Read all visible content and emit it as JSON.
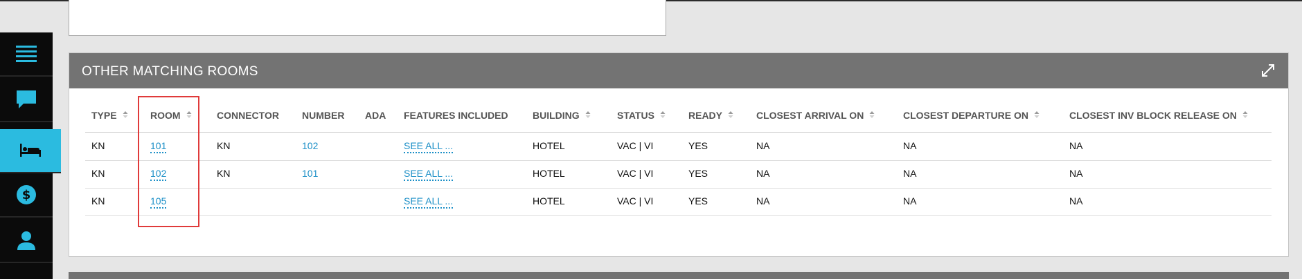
{
  "sidebar": {
    "items": [
      {
        "icon": "menu-icon",
        "active": false
      },
      {
        "icon": "chat-icon",
        "active": false
      },
      {
        "icon": "bed-icon",
        "active": true
      },
      {
        "icon": "dollar-icon",
        "active": false
      },
      {
        "icon": "user-icon",
        "active": false
      }
    ]
  },
  "card": {
    "title": "OTHER MATCHING ROOMS",
    "expand_icon": "expand-icon"
  },
  "table": {
    "headers": {
      "type": "TYPE",
      "room": "ROOM",
      "connector": "CONNECTOR",
      "number": "NUMBER",
      "ada": "ADA",
      "features": "FEATURES INCLUDED",
      "building": "BUILDING",
      "status": "STATUS",
      "ready": "READY",
      "arrival": "CLOSEST ARRIVAL ON",
      "departure": "CLOSEST DEPARTURE ON",
      "inv_block": "CLOSEST INV BLOCK RELEASE ON"
    },
    "rows": [
      {
        "type": "KN",
        "room": "101",
        "connector": "KN",
        "number": "102",
        "ada": "",
        "features": "SEE ALL ...",
        "building": "HOTEL",
        "status": "VAC | VI",
        "ready": "YES",
        "arrival": "NA",
        "departure": "NA",
        "inv_block": "NA"
      },
      {
        "type": "KN",
        "room": "102",
        "connector": "KN",
        "number": "101",
        "ada": "",
        "features": "SEE ALL ...",
        "building": "HOTEL",
        "status": "VAC | VI",
        "ready": "YES",
        "arrival": "NA",
        "departure": "NA",
        "inv_block": "NA"
      },
      {
        "type": "KN",
        "room": "105",
        "connector": "",
        "number": "",
        "ada": "",
        "features": "SEE ALL ...",
        "building": "HOTEL",
        "status": "VAC | VI",
        "ready": "YES",
        "arrival": "NA",
        "departure": "NA",
        "inv_block": "NA"
      }
    ]
  },
  "colors": {
    "accent": "#2bbbe0",
    "link": "#1b8fc7",
    "header_bg": "#737373",
    "highlight": "#e03a3a",
    "sidebar_bg": "#0b0b0b"
  }
}
